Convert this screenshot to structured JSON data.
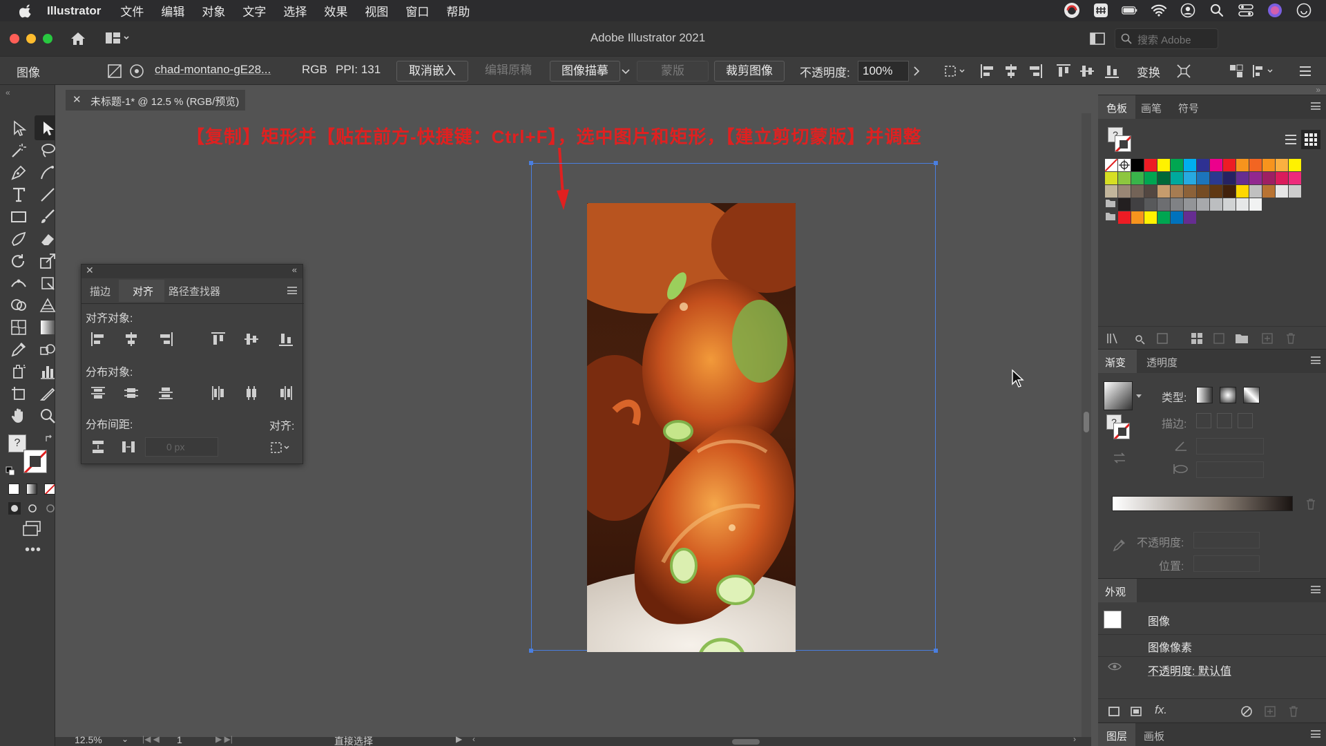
{
  "menubar": {
    "app_name": "Illustrator",
    "items": [
      "文件",
      "编辑",
      "对象",
      "文字",
      "选择",
      "效果",
      "视图",
      "窗口",
      "帮助"
    ]
  },
  "titlebar": {
    "title": "Adobe Illustrator 2021",
    "search_placeholder": "搜索 Adobe"
  },
  "controlbar": {
    "selection_type": "图像",
    "filename": "chad-montano-gE28...",
    "color_mode": "RGB",
    "ppi": "PPI: 131",
    "unembed": "取消嵌入",
    "edit_original": "编辑原稿",
    "image_trace": "图像描摹",
    "mask": "蒙版",
    "crop_image": "裁剪图像",
    "opacity_label": "不透明度:",
    "opacity_value": "100%",
    "transform": "变换"
  },
  "document": {
    "tab_title": "未标题-1* @ 12.5 % (RGB/预览)",
    "instruction": "【复制】矩形并【贴在前方-快捷键：Ctrl+F】，选中图片和矩形，【建立剪切蒙版】并调整"
  },
  "align_panel": {
    "tabs": [
      "描边",
      "对齐",
      "路径查找器"
    ],
    "active_tab": "对齐",
    "align_objects_label": "对齐对象:",
    "distribute_objects_label": "分布对象:",
    "distribute_spacing_label": "分布间距:",
    "align_to_label": "对齐:",
    "spacing_value": "0 px"
  },
  "swatches_panel": {
    "tabs": [
      "色板",
      "画笔",
      "符号"
    ],
    "active_tab": "色板",
    "row1": [
      "#ffffff",
      "#ffffff",
      "#000000",
      "#ed1c24",
      "#fff200",
      "#00a651",
      "#00aeef",
      "#2e3192",
      "#ec008c",
      "#ed1c24",
      "#f7941d",
      "#f26522",
      "#f7941d",
      "#fbb040",
      "#fff200"
    ],
    "row2": [
      "#d7df23",
      "#8dc63f",
      "#39b54a",
      "#00a651",
      "#006838",
      "#00a99d",
      "#27aae1",
      "#1c75bc",
      "#2b3990",
      "#262262",
      "#662d91",
      "#92278f",
      "#9e1f63",
      "#da1c5c",
      "#ee2a7b"
    ],
    "row3": [
      "#c2b59b",
      "#998675",
      "#736357",
      "#534741",
      "#c69c6d",
      "#a67c52",
      "#8c6239",
      "#754c24",
      "#603813",
      "#42210b",
      "#ffd700",
      "#c0c0c0",
      "#b87333",
      "#e6e6e6",
      "#cccccc"
    ],
    "row4": [
      "#231f20",
      "#414042",
      "#58595b",
      "#6d6e71",
      "#808285",
      "#939598",
      "#a7a9ac",
      "#bcbec0",
      "#d1d3d4",
      "#e6e7e8",
      "#f1f2f2"
    ],
    "row5": [
      "#ed1c24",
      "#f7941d",
      "#fff200",
      "#00a651",
      "#0072bc",
      "#662d91"
    ]
  },
  "gradient_panel": {
    "tabs": [
      "渐变",
      "透明度"
    ],
    "active_tab": "渐变",
    "type_label": "类型:",
    "stroke_label": "描边:",
    "opacity_label": "不透明度:",
    "location_label": "位置:"
  },
  "appearance_panel": {
    "title": "外观",
    "object_name": "图像",
    "row_pixels": "图像像素",
    "row_opacity": "不透明度: 默认值",
    "fx_label": "fx."
  },
  "layers_panel": {
    "tabs": [
      "图层",
      "画板"
    ]
  },
  "statusbar": {
    "zoom": "12.5%",
    "artboard": "1",
    "tool": "直接选择"
  },
  "colors": {
    "accent_red": "#e02020",
    "selection_blue": "#4a7fe0",
    "panel_bg": "#3c3c3c",
    "canvas_bg": "#535353"
  }
}
